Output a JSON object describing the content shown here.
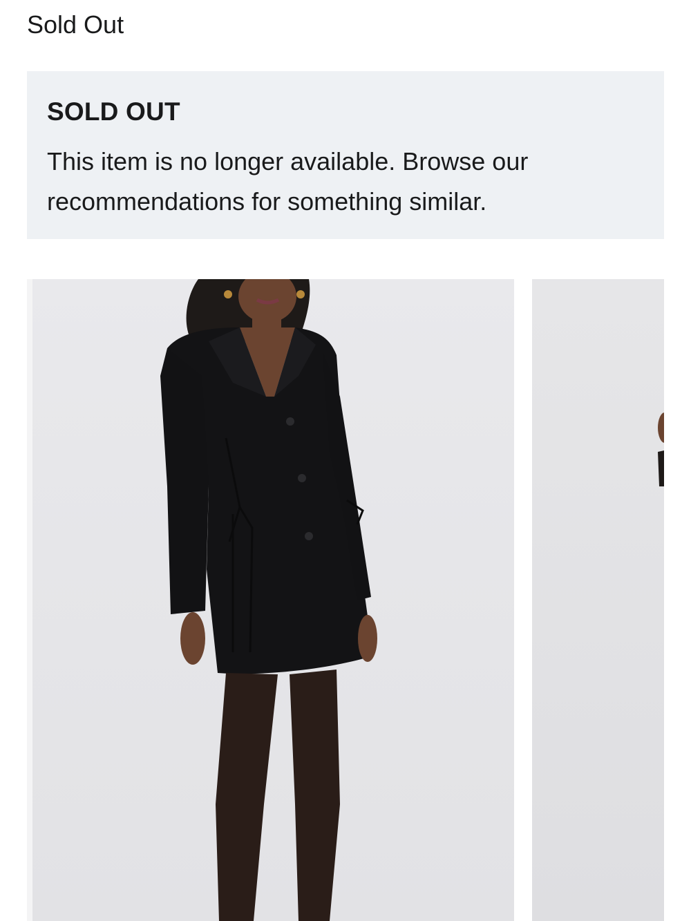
{
  "header": {
    "status": "Sold Out"
  },
  "notice": {
    "title": "SOLD OUT",
    "body": "This item is no longer available. Browse our recommendations for something similar."
  },
  "gallery": {
    "images": [
      {
        "label": "product-image-black-blazer-dress-front"
      },
      {
        "label": "product-image-next-partial"
      }
    ]
  }
}
